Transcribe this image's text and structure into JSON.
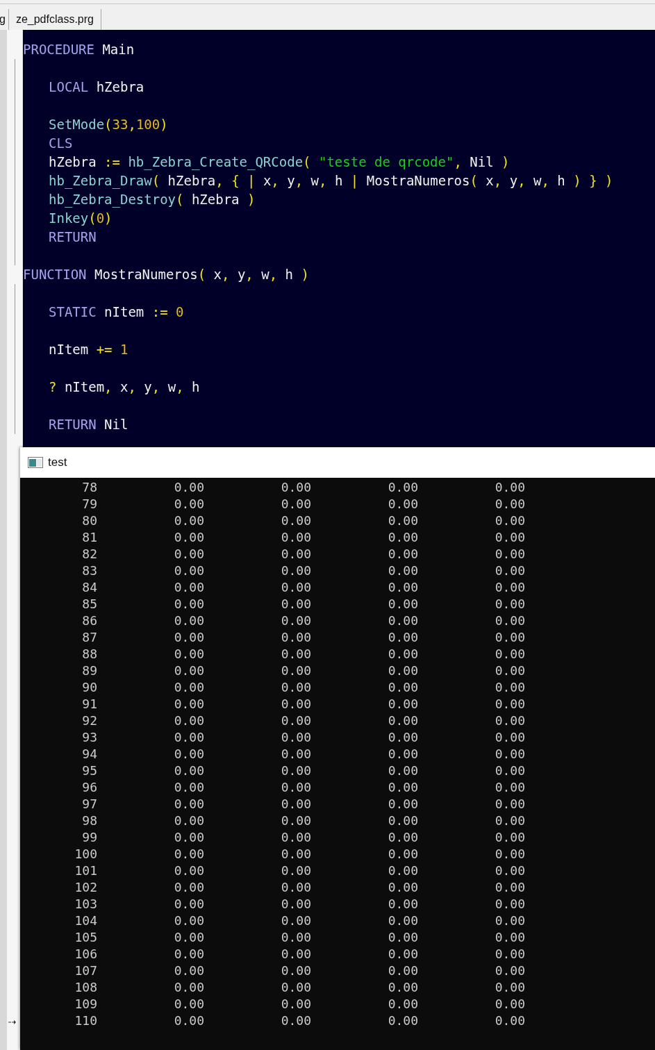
{
  "tabs": [
    {
      "label": "g",
      "selected": false
    },
    {
      "label": "ze_pdfclass.prg",
      "selected": false
    }
  ],
  "editor": {
    "blocks": [
      {
        "header": [
          {
            "kind": "keyword",
            "text": "PROCEDURE"
          },
          {
            "kind": "name",
            "text": " Main"
          }
        ],
        "lines": [
          {
            "kind": "blank"
          },
          {
            "kind": "code",
            "tokens": [
              {
                "kind": "keyword",
                "text": "LOCAL"
              },
              {
                "kind": "name",
                "text": " hZebra"
              }
            ]
          },
          {
            "kind": "blank"
          },
          {
            "kind": "code",
            "tokens": [
              {
                "kind": "call",
                "text": "SetMode"
              },
              {
                "kind": "symbol",
                "text": "("
              },
              {
                "kind": "number",
                "text": "33"
              },
              {
                "kind": "symbol",
                "text": ","
              },
              {
                "kind": "number",
                "text": "100"
              },
              {
                "kind": "symbol",
                "text": ")"
              }
            ]
          },
          {
            "kind": "code",
            "tokens": [
              {
                "kind": "keyword",
                "text": "CLS"
              }
            ]
          },
          {
            "kind": "code",
            "tokens": [
              {
                "kind": "name",
                "text": "hZebra "
              },
              {
                "kind": "symbol",
                "text": ":="
              },
              {
                "kind": "call",
                "text": " hb_Zebra_Create_QRCode"
              },
              {
                "kind": "symbol",
                "text": "("
              },
              {
                "kind": "string",
                "text": " \"teste de qrcode\""
              },
              {
                "kind": "symbol",
                "text": ","
              },
              {
                "kind": "name",
                "text": " Nil "
              },
              {
                "kind": "symbol",
                "text": ")"
              }
            ]
          },
          {
            "kind": "code",
            "tokens": [
              {
                "kind": "call",
                "text": "hb_Zebra_Draw"
              },
              {
                "kind": "symbol",
                "text": "("
              },
              {
                "kind": "name",
                "text": " hZebra"
              },
              {
                "kind": "symbol",
                "text": ","
              },
              {
                "kind": "symbol",
                "text": " { |"
              },
              {
                "kind": "name",
                "text": " x"
              },
              {
                "kind": "symbol",
                "text": ","
              },
              {
                "kind": "name",
                "text": " y"
              },
              {
                "kind": "symbol",
                "text": ","
              },
              {
                "kind": "name",
                "text": " w"
              },
              {
                "kind": "symbol",
                "text": ","
              },
              {
                "kind": "name",
                "text": " h"
              },
              {
                "kind": "symbol",
                "text": " |"
              },
              {
                "kind": "name",
                "text": " MostraNumeros"
              },
              {
                "kind": "symbol",
                "text": "("
              },
              {
                "kind": "name",
                "text": " x"
              },
              {
                "kind": "symbol",
                "text": ","
              },
              {
                "kind": "name",
                "text": " y"
              },
              {
                "kind": "symbol",
                "text": ","
              },
              {
                "kind": "name",
                "text": " w"
              },
              {
                "kind": "symbol",
                "text": ","
              },
              {
                "kind": "name",
                "text": " h "
              },
              {
                "kind": "symbol",
                "text": ") } )"
              }
            ]
          },
          {
            "kind": "code",
            "tokens": [
              {
                "kind": "call",
                "text": "hb_Zebra_Destroy"
              },
              {
                "kind": "symbol",
                "text": "("
              },
              {
                "kind": "name",
                "text": " hZebra "
              },
              {
                "kind": "symbol",
                "text": ")"
              }
            ]
          },
          {
            "kind": "code",
            "tokens": [
              {
                "kind": "call",
                "text": "Inkey"
              },
              {
                "kind": "symbol",
                "text": "("
              },
              {
                "kind": "number",
                "text": "0"
              },
              {
                "kind": "symbol",
                "text": ")"
              }
            ]
          },
          {
            "kind": "code",
            "tokens": [
              {
                "kind": "keyword",
                "text": "RETURN"
              }
            ]
          },
          {
            "kind": "blank"
          }
        ]
      },
      {
        "header": [
          {
            "kind": "keyword",
            "text": "FUNCTION"
          },
          {
            "kind": "name",
            "text": " MostraNumeros"
          },
          {
            "kind": "symbol",
            "text": "("
          },
          {
            "kind": "name",
            "text": " x"
          },
          {
            "kind": "symbol",
            "text": ","
          },
          {
            "kind": "name",
            "text": " y"
          },
          {
            "kind": "symbol",
            "text": ","
          },
          {
            "kind": "name",
            "text": " w"
          },
          {
            "kind": "symbol",
            "text": ","
          },
          {
            "kind": "name",
            "text": " h "
          },
          {
            "kind": "symbol",
            "text": ")"
          }
        ],
        "lines": [
          {
            "kind": "blank"
          },
          {
            "kind": "code",
            "tokens": [
              {
                "kind": "keyword",
                "text": "STATIC"
              },
              {
                "kind": "name",
                "text": " nItem "
              },
              {
                "kind": "symbol",
                "text": ":="
              },
              {
                "kind": "number",
                "text": " 0"
              }
            ]
          },
          {
            "kind": "blank"
          },
          {
            "kind": "code",
            "tokens": [
              {
                "kind": "name",
                "text": "nItem "
              },
              {
                "kind": "symbol",
                "text": "+="
              },
              {
                "kind": "number",
                "text": " 1"
              }
            ]
          },
          {
            "kind": "blank"
          },
          {
            "kind": "code",
            "tokens": [
              {
                "kind": "symbol",
                "text": "?"
              },
              {
                "kind": "name",
                "text": " nItem"
              },
              {
                "kind": "symbol",
                "text": ","
              },
              {
                "kind": "name",
                "text": " x"
              },
              {
                "kind": "symbol",
                "text": ","
              },
              {
                "kind": "name",
                "text": " y"
              },
              {
                "kind": "symbol",
                "text": ","
              },
              {
                "kind": "name",
                "text": " w"
              },
              {
                "kind": "symbol",
                "text": ","
              },
              {
                "kind": "name",
                "text": " h"
              }
            ]
          },
          {
            "kind": "blank"
          },
          {
            "kind": "code",
            "tokens": [
              {
                "kind": "keyword",
                "text": "RETURN"
              },
              {
                "kind": "name",
                "text": " Nil"
              }
            ]
          }
        ]
      }
    ]
  },
  "console": {
    "title": "test",
    "rows": [
      [
        "78",
        "0.00",
        "0.00",
        "0.00",
        "0.00"
      ],
      [
        "79",
        "0.00",
        "0.00",
        "0.00",
        "0.00"
      ],
      [
        "80",
        "0.00",
        "0.00",
        "0.00",
        "0.00"
      ],
      [
        "81",
        "0.00",
        "0.00",
        "0.00",
        "0.00"
      ],
      [
        "82",
        "0.00",
        "0.00",
        "0.00",
        "0.00"
      ],
      [
        "83",
        "0.00",
        "0.00",
        "0.00",
        "0.00"
      ],
      [
        "84",
        "0.00",
        "0.00",
        "0.00",
        "0.00"
      ],
      [
        "85",
        "0.00",
        "0.00",
        "0.00",
        "0.00"
      ],
      [
        "86",
        "0.00",
        "0.00",
        "0.00",
        "0.00"
      ],
      [
        "87",
        "0.00",
        "0.00",
        "0.00",
        "0.00"
      ],
      [
        "88",
        "0.00",
        "0.00",
        "0.00",
        "0.00"
      ],
      [
        "89",
        "0.00",
        "0.00",
        "0.00",
        "0.00"
      ],
      [
        "90",
        "0.00",
        "0.00",
        "0.00",
        "0.00"
      ],
      [
        "91",
        "0.00",
        "0.00",
        "0.00",
        "0.00"
      ],
      [
        "92",
        "0.00",
        "0.00",
        "0.00",
        "0.00"
      ],
      [
        "93",
        "0.00",
        "0.00",
        "0.00",
        "0.00"
      ],
      [
        "94",
        "0.00",
        "0.00",
        "0.00",
        "0.00"
      ],
      [
        "95",
        "0.00",
        "0.00",
        "0.00",
        "0.00"
      ],
      [
        "96",
        "0.00",
        "0.00",
        "0.00",
        "0.00"
      ],
      [
        "97",
        "0.00",
        "0.00",
        "0.00",
        "0.00"
      ],
      [
        "98",
        "0.00",
        "0.00",
        "0.00",
        "0.00"
      ],
      [
        "99",
        "0.00",
        "0.00",
        "0.00",
        "0.00"
      ],
      [
        "100",
        "0.00",
        "0.00",
        "0.00",
        "0.00"
      ],
      [
        "101",
        "0.00",
        "0.00",
        "0.00",
        "0.00"
      ],
      [
        "102",
        "0.00",
        "0.00",
        "0.00",
        "0.00"
      ],
      [
        "103",
        "0.00",
        "0.00",
        "0.00",
        "0.00"
      ],
      [
        "104",
        "0.00",
        "0.00",
        "0.00",
        "0.00"
      ],
      [
        "105",
        "0.00",
        "0.00",
        "0.00",
        "0.00"
      ],
      [
        "106",
        "0.00",
        "0.00",
        "0.00",
        "0.00"
      ],
      [
        "107",
        "0.00",
        "0.00",
        "0.00",
        "0.00"
      ],
      [
        "108",
        "0.00",
        "0.00",
        "0.00",
        "0.00"
      ],
      [
        "109",
        "0.00",
        "0.00",
        "0.00",
        "0.00"
      ],
      [
        "110",
        "0.00",
        "0.00",
        "0.00",
        "0.00"
      ]
    ]
  }
}
